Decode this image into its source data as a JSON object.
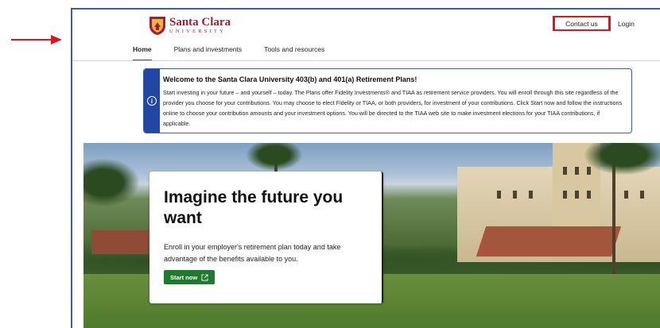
{
  "header": {
    "logo_name": "Santa Clara",
    "logo_sub": "UNIVERSITY",
    "contact_label": "Contact us",
    "login_label": "Login"
  },
  "nav": {
    "items": [
      {
        "label": "Home",
        "active": true
      },
      {
        "label": "Plans and investments",
        "active": false
      },
      {
        "label": "Tools and resources",
        "active": false
      }
    ]
  },
  "notice": {
    "icon": "info-icon",
    "title": "Welcome to the Santa Clara University 403(b) and 401(a) Retirement Plans!",
    "body": "Start investing in your future – and yourself – today. The Plans offer Fidelity Investments® and TIAA as retirement service providers. You will enroll through this site regardless of the provider you choose for your contributions. You may choose to elect Fidelity or TIAA, or both providers, for investment of your contributions. Click Start now and follow the instructions online to choose your contribution amounts and your investment options. You will be directed to the TIAA web site to make investment elections for your TIAA contributions, if applicable."
  },
  "hero": {
    "title": "Imagine the future you want",
    "body": "Enroll in your employer's retirement plan today and take advantage of the benefits available to you.",
    "button_label": "Start now",
    "button_icon": "external-link-icon"
  },
  "colors": {
    "brand": "#a31f34",
    "accent_green": "#1f7a30",
    "notice_blue": "#2246a4",
    "highlight_red": "#e0141e"
  }
}
